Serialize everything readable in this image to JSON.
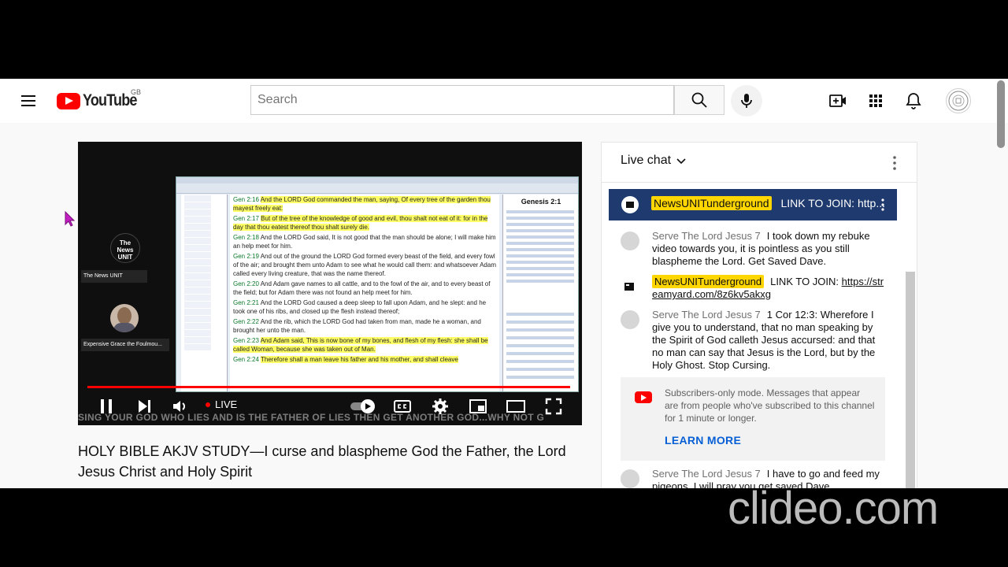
{
  "header": {
    "brand": "YouTube",
    "region": "GB",
    "search_placeholder": "Search",
    "icons": [
      "menu-icon",
      "search-icon",
      "mic-icon",
      "create-icon",
      "apps-icon",
      "bell-icon"
    ]
  },
  "player": {
    "live_label": "LIVE",
    "progress": 0.995,
    "ticker": "SING YOUR GOD WHO LIES AND IS THE FATHER OF LIES THEN GET ANOTHER GOD...WHY NOT G",
    "participants": [
      {
        "avatar_text": "The News UNIT",
        "label": "The News UNIT"
      },
      {
        "label": "Expensive Grace the Foulmou..."
      }
    ],
    "screen": {
      "side_title": "Genesis 2:1",
      "verses": [
        {
          "ref": "Gen 2:16",
          "text": "And the LORD God commanded the man, saying, Of every tree of the garden thou mayest freely eat:"
        },
        {
          "ref": "Gen 2:17",
          "text": "But of the tree of the knowledge of good and evil, thou shalt not eat of it: for in the day that thou eatest thereof thou shalt surely die."
        },
        {
          "ref": "Gen 2:18",
          "text": "And the LORD God said, It is not good that the man should be alone; I will make him an help meet for him."
        },
        {
          "ref": "Gen 2:19",
          "text": "And out of the ground the LORD God formed every beast of the field, and every fowl of the air; and brought them unto Adam to see what he would call them: and whatsoever Adam called every living creature, that was the name thereof."
        },
        {
          "ref": "Gen 2:20",
          "text": "And Adam gave names to all cattle, and to the fowl of the air, and to every beast of the field; but for Adam there was not found an help meet for him."
        },
        {
          "ref": "Gen 2:21",
          "text": "And the LORD God caused a deep sleep to fall upon Adam, and he slept: and he took one of his ribs, and closed up the flesh instead thereof;"
        },
        {
          "ref": "Gen 2:22",
          "text": "And the rib, which the LORD God had taken from man, made he a woman, and brought her unto the man."
        },
        {
          "ref": "Gen 2:23",
          "text": "And Adam said, This is now bone of my bones, and flesh of my flesh: she shall be called Woman, because she was taken out of Man."
        },
        {
          "ref": "Gen 2:24",
          "text": "Therefore shall a man leave his father and his mother, and shall cleave"
        }
      ]
    }
  },
  "video": {
    "title": "HOLY BIBLE AKJV STUDY—I curse and blaspheme God the Father, the Lord Jesus Christ and Holy Spirit"
  },
  "chat": {
    "title": "Live chat",
    "pinned": {
      "author": "NewsUNITunderground",
      "text": "LINK TO JOIN: http..."
    },
    "messages": [
      {
        "author": "Serve The Lord Jesus 7",
        "text": "I took down my rebuke video towards you, it is pointless as you still blaspheme the Lord. Get Saved Dave."
      },
      {
        "author": "NewsUNITunderground",
        "text": "LINK TO JOIN: ",
        "link": "https://streamyard.com/8z6kv5akxg"
      },
      {
        "author": "Serve The Lord Jesus 7",
        "text": "1 Cor 12:3: Wherefore I give you to understand, that no man speaking by the Spirit of God calleth Jesus accursed: and that no man can say that Jesus is the Lord, but by the Holy Ghost. Stop Cursing."
      },
      {
        "author": "Serve The Lord Jesus 7",
        "text": "I have to go and feed my pigeons. I will pray you get saved Dave."
      }
    ],
    "notice": {
      "text": "Subscribers-only mode. Messages that appear are from people who've subscribed to this channel for 1 minute or longer.",
      "action": "LEARN MORE"
    }
  },
  "watermark": "clideo.com",
  "colors": {
    "brand_red": "#ff0000",
    "pinned_bg": "#1f3a6e",
    "author_chip": "#ffd600",
    "link_blue": "#065fd4"
  }
}
